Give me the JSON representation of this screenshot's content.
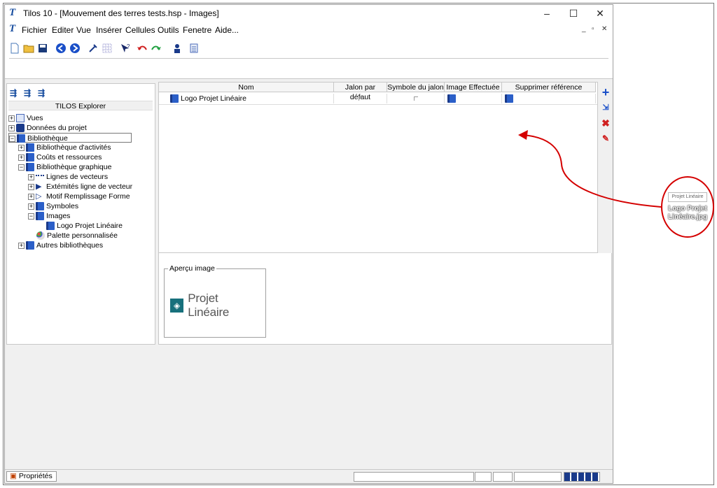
{
  "window": {
    "title": "Tilos 10  - [Mouvement des terres tests.hsp -  Images]",
    "app_icon": "T"
  },
  "menu": [
    "Fichier",
    "Editer",
    "Vue",
    "Insérer",
    "Cellules",
    "Outils",
    "Fenetre",
    "Aide..."
  ],
  "explorer": {
    "title": "TILOS Explorer",
    "tree": [
      {
        "label": "Vues"
      },
      {
        "label": "Données du projet"
      },
      {
        "label": "Bibliothèque"
      },
      {
        "label": "Bibliothèque d'activités"
      },
      {
        "label": "Coûts et ressources"
      },
      {
        "label": "Bibliothèque graphique"
      },
      {
        "label": "Lignes de vecteurs"
      },
      {
        "label": "Extémités ligne de vecteur"
      },
      {
        "label": "Motif Remplissage Forme"
      },
      {
        "label": "Symboles"
      },
      {
        "label": "Images"
      },
      {
        "label": "Logo Projet Linéaire"
      },
      {
        "label": "Palette personnalisée"
      },
      {
        "label": "Autres bibliothèques"
      }
    ]
  },
  "grid": {
    "columns": [
      "Nom",
      "Jalon par défaut",
      "Symbole du jalon",
      "Image Effectuée",
      "Supprimer référence"
    ],
    "rows": [
      {
        "name": "Logo Projet Linéaire"
      }
    ]
  },
  "preview": {
    "label": "Aperçu image",
    "logo_text": "Projet Linéaire"
  },
  "status": {
    "properties_label": "Propriétés"
  },
  "annotation": {
    "thumb_text": "Projet Linéaire",
    "file_name": "Logo Projet Linéaire.jpg"
  },
  "colors": {
    "accent": "#1a4fa0",
    "annotation_red": "#d40000",
    "logo_teal": "#17707c"
  }
}
